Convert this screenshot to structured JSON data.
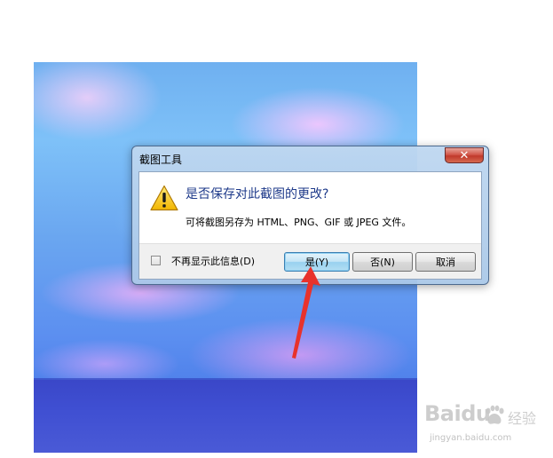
{
  "dialog": {
    "title": "截图工具",
    "close_icon": "close-icon",
    "main_instruction": "是否保存对此截图的更改?",
    "sub_text": "可将截图另存为 HTML、PNG、GIF 或 JPEG 文件。",
    "icon": "warning-icon",
    "checkbox": {
      "label": "不再显示此信息(D)",
      "checked": false
    },
    "buttons": {
      "yes": "是(Y)",
      "no": "否(N)",
      "cancel": "取消"
    }
  },
  "annotation": {
    "arrow_color": "#e8322c",
    "points_to": "yes-button"
  },
  "watermark": {
    "brand": "Baidu",
    "sub": "经验",
    "url": "jingyan.baidu.com"
  },
  "colors": {
    "instruction_text": "#1e3a8a",
    "close_button": "#c0392b",
    "default_button_border": "#3c7fb1"
  }
}
